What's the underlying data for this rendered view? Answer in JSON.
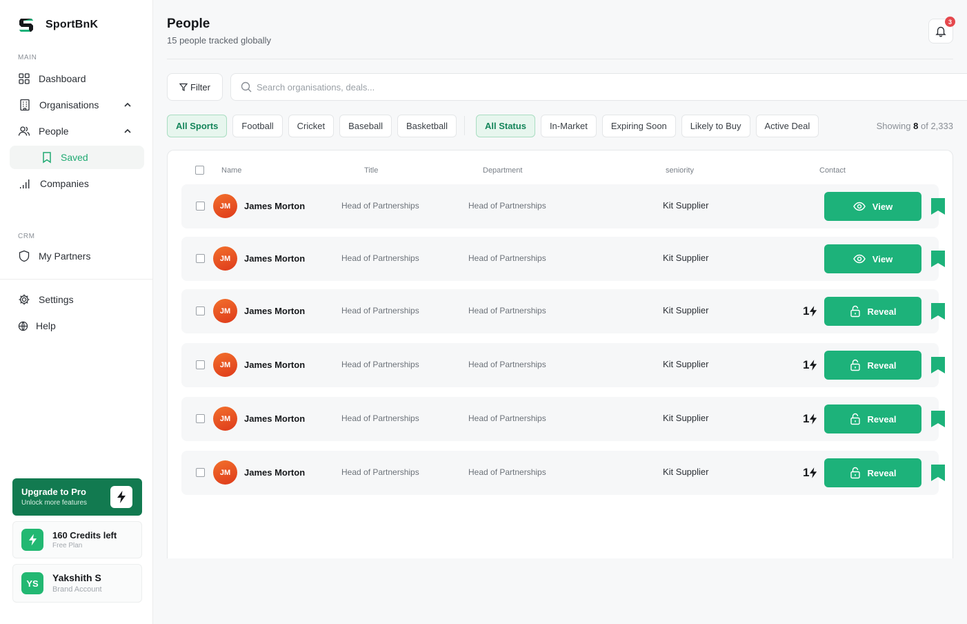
{
  "sidebar": {
    "brand": "SportBnK",
    "main_label": "MAIN",
    "crm_label": "CRM",
    "items": {
      "dashboard": "Dashboard",
      "organisations": "Organisations",
      "people": "People",
      "saved": "Saved",
      "companies": "Companies",
      "my_partners": "My Partners",
      "settings": "Settings",
      "help": "Help"
    },
    "upgrade": {
      "title": "Upgrade to Pro",
      "subtitle": "Unlock more features"
    },
    "credits": {
      "title": "160 Credits left",
      "subtitle": "Free Plan"
    },
    "user": {
      "initials": "YS",
      "name": "Yakshith S",
      "role": "Brand Account"
    }
  },
  "header": {
    "title": "People",
    "subtitle": "15 people tracked globally",
    "notification_count": "3"
  },
  "toolbar": {
    "filter_label": "Filter",
    "search_placeholder": "Search organisations, deals...",
    "search_value": ""
  },
  "filters": {
    "sports": [
      "All Sports",
      "Football",
      "Cricket",
      "Baseball",
      "Basketball"
    ],
    "status": [
      "All Status",
      "In-Market",
      "Expiring Soon",
      "Likely to Buy",
      "Active Deal"
    ],
    "active_sport": "All Sports",
    "active_status": "All Status",
    "showing_prefix": "Showing",
    "showing_count": "8",
    "showing_total": "of 2,333"
  },
  "table": {
    "columns": [
      "Name",
      "Title",
      "Department",
      "seniority",
      "Contact"
    ],
    "rows": [
      {
        "initials": "JM",
        "name": "James Morton",
        "title": "Head of Partnerships",
        "department": "Head of Partnerships",
        "seniority": "Kit Supplier",
        "cost": "",
        "action": "View",
        "action_icon": "eye-icon"
      },
      {
        "initials": "JM",
        "name": "James Morton",
        "title": "Head of Partnerships",
        "department": "Head of Partnerships",
        "seniority": "Kit Supplier",
        "cost": "",
        "action": "View",
        "action_icon": "eye-icon"
      },
      {
        "initials": "JM",
        "name": "James Morton",
        "title": "Head of Partnerships",
        "department": "Head of Partnerships",
        "seniority": "Kit Supplier",
        "cost": "1",
        "action": "Reveal",
        "action_icon": "lock-icon"
      },
      {
        "initials": "JM",
        "name": "James Morton",
        "title": "Head of Partnerships",
        "department": "Head of Partnerships",
        "seniority": "Kit Supplier",
        "cost": "1",
        "action": "Reveal",
        "action_icon": "lock-icon"
      },
      {
        "initials": "JM",
        "name": "James Morton",
        "title": "Head of Partnerships",
        "department": "Head of Partnerships",
        "seniority": "Kit Supplier",
        "cost": "1",
        "action": "Reveal",
        "action_icon": "lock-icon"
      },
      {
        "initials": "JM",
        "name": "James Morton",
        "title": "Head of Partnerships",
        "department": "Head of Partnerships",
        "seniority": "Kit Supplier",
        "cost": "1",
        "action": "Reveal",
        "action_icon": "lock-icon"
      }
    ]
  },
  "colors": {
    "accent": "#1db27a",
    "accent_dark": "#127a50",
    "badge": "#e5484d",
    "avatar": "#e8501f"
  }
}
